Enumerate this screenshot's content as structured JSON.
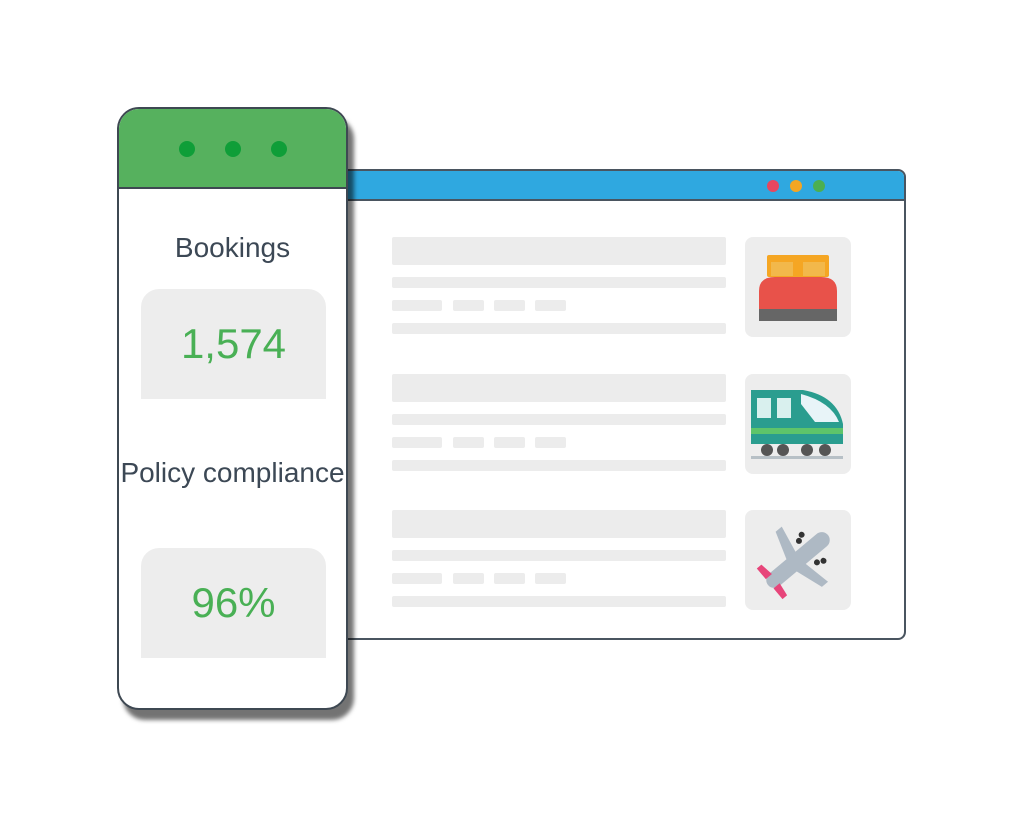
{
  "dashboard": {
    "window_controls": [
      "dot-1",
      "dot-2",
      "dot-3"
    ],
    "stats": [
      {
        "label": "Bookings",
        "value": "1,574"
      },
      {
        "label": "Policy compliance",
        "value": "96%"
      }
    ]
  },
  "browser": {
    "window_controls": [
      {
        "color": "#e8475f"
      },
      {
        "color": "#f3a623"
      },
      {
        "color": "#4caf50"
      }
    ],
    "results": [
      {
        "icon": "bed-icon"
      },
      {
        "icon": "train-icon"
      },
      {
        "icon": "airplane-icon"
      }
    ]
  },
  "colors": {
    "dashboard_header": "#56b15e",
    "browser_header": "#2fa8e0",
    "stat_value": "#49b055"
  }
}
